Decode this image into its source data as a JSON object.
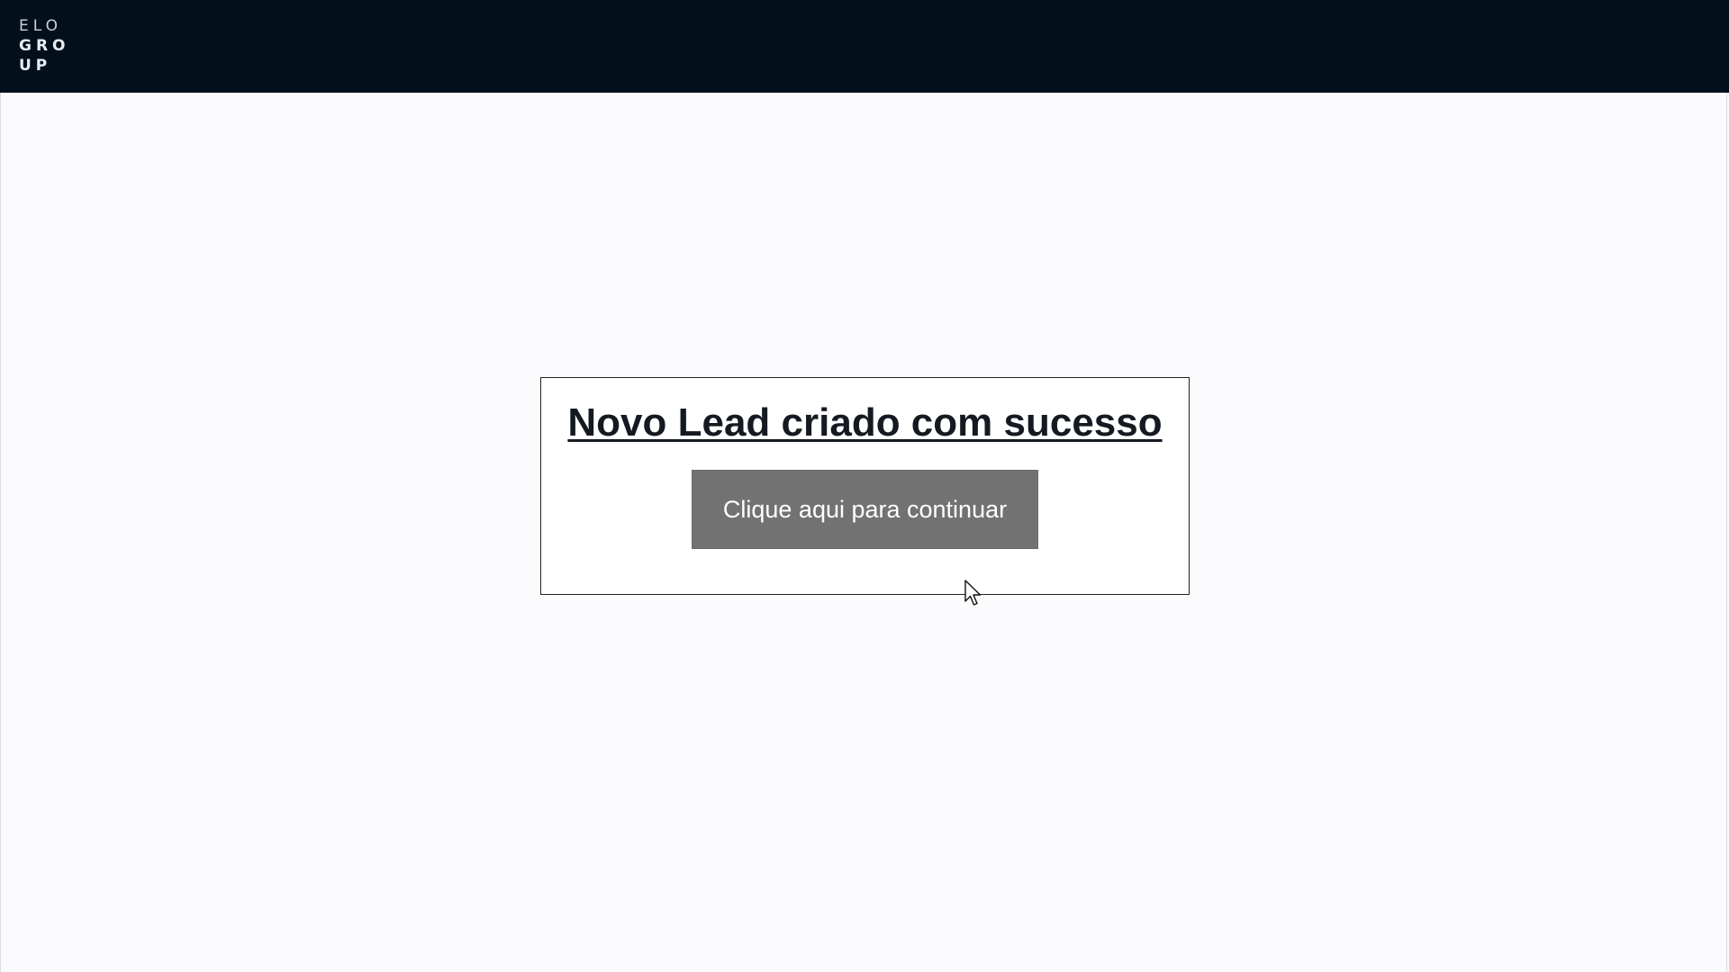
{
  "header": {
    "logo_line1": "ELO",
    "logo_line2": "GRO",
    "logo_line3": "UP",
    "background": "#03101c"
  },
  "card": {
    "title": "Novo Lead criado com sucesso",
    "button_label": "Clique aqui para continuar",
    "button_color": "#727272"
  },
  "cursor": {
    "icon": "mouse-pointer-icon"
  }
}
